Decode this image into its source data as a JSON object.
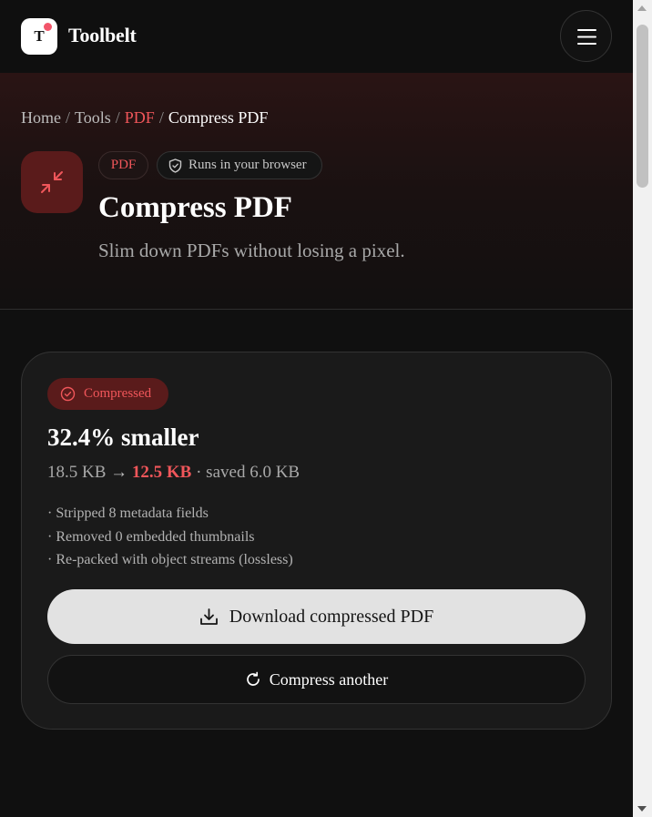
{
  "header": {
    "logo_letter": "T",
    "brand": "Toolbelt",
    "menu_icon": "hamburger-icon"
  },
  "breadcrumb": {
    "items": [
      "Home",
      "Tools",
      "PDF"
    ],
    "current": "Compress PDF",
    "separator": "/"
  },
  "hero": {
    "icon": "compress-arrows-icon",
    "category_chip": "PDF",
    "privacy_chip": "Runs in your browser",
    "title": "Compress PDF",
    "subtitle": "Slim down PDFs without losing a pixel."
  },
  "result": {
    "status": "Compressed",
    "headline": "32.4% smaller",
    "original_size": "18.5 KB",
    "arrow": "→",
    "new_size": "12.5 KB",
    "saved": "· saved 6.0 KB",
    "details": [
      "· Stripped 8 metadata fields",
      "· Removed 0 embedded thumbnails",
      "· Re-packed with object streams (lossless)"
    ],
    "download_label": "Download compressed PDF",
    "again_label": "Compress another"
  },
  "colors": {
    "accent": "#f0565a",
    "background": "#101010",
    "card": "#1a1a1a",
    "primary_button": "#e2e2e2"
  }
}
